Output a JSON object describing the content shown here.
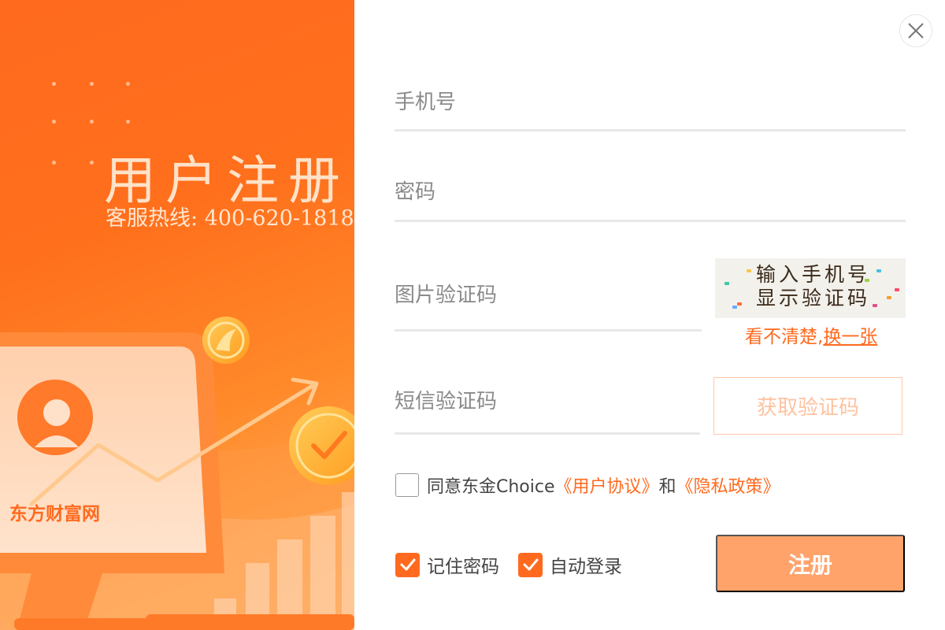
{
  "brand": {
    "title": "用户注册",
    "hotline": "客服热线: 400-620-1818",
    "logo_text": "东方财富网"
  },
  "form": {
    "phone_placeholder": "手机号",
    "password_placeholder": "密码",
    "image_captcha_placeholder": "图片验证码",
    "captcha_image_text_line1": "输入手机号",
    "captcha_image_text_line2": "显示验证码",
    "captcha_unclear_text": "看不清楚,",
    "captcha_refresh_link": "换一张",
    "sms_code_placeholder": "短信验证码",
    "get_code_button": "获取验证码",
    "agree_prefix": "同意东金Choice",
    "user_agreement_link": "《用户协议》",
    "agree_and": "和",
    "privacy_policy_link": "《隐私政策》",
    "remember_password_label": "记住密码",
    "remember_password_checked": true,
    "auto_login_label": "自动登录",
    "auto_login_checked": true,
    "agree_checked": false,
    "register_button": "注册"
  },
  "icons": {
    "close": "close-icon",
    "avatar": "user-avatar-icon",
    "check_coin": "checkmark-icon",
    "brand_coin": "brand-coin-icon",
    "trend_arrow": "trend-arrow-icon"
  },
  "colors": {
    "accent": "#ff6a1f",
    "register_button": "#ffa36b",
    "sms_button_border": "#ffc7a6",
    "field_text": "#8a8a8a",
    "divider": "#e8e8e8"
  }
}
